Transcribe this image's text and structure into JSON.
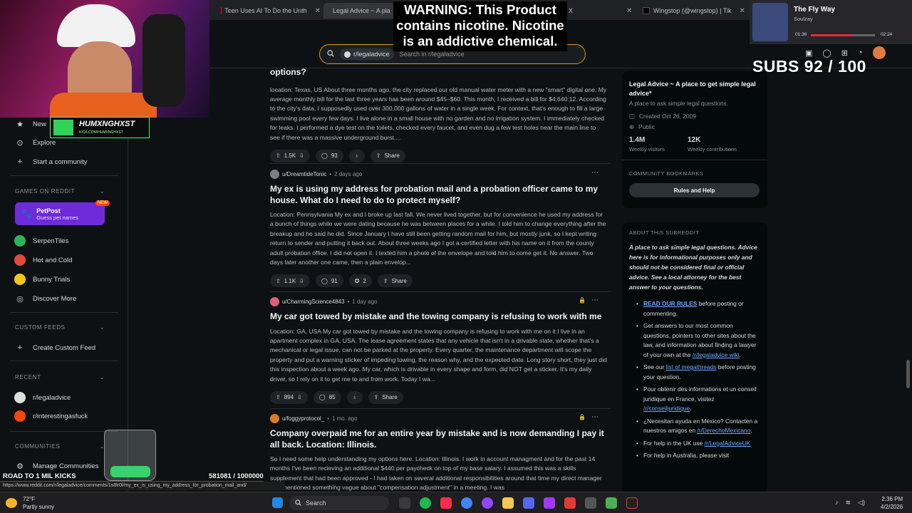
{
  "browser_tabs": [
    {
      "label": "Teen Uses AI To Do the Unth",
      "color": "#ff0000"
    },
    {
      "label": "Legal Advice ~ A pla",
      "color": "#ff4500",
      "active": true
    },
    {
      "label": "X",
      "color": "#ffffff"
    },
    {
      "label": "Wingstop (@wingstop) | Tik",
      "color": "#000000"
    }
  ],
  "search": {
    "community_chip": "r/legaladvice",
    "placeholder": "Search in r/legaladvice"
  },
  "sidebar": {
    "new": "New",
    "explore": "Explore",
    "start_community": "Start a community",
    "games_header": "GAMES ON REDDIT",
    "petpost_title": "PetPost",
    "petpost_sub": "Guess pet names",
    "new_badge": "NEW",
    "games": [
      "SerpenTiles",
      "Hot and Cold",
      "Bunny Trials",
      "Discover More"
    ],
    "custom_feeds_header": "CUSTOM FEEDS",
    "create_custom_feed": "Create Custom Feed",
    "recent_header": "RECENT",
    "recent": [
      "r/legaladvice",
      "r/interestingasfuck"
    ],
    "communities_header": "COMMUNITIES",
    "manage_communities": "Manage Communities"
  },
  "posts": [
    {
      "title_partial": "options?",
      "body": "location: Texas, US About three months ago, the city replaced our old manual water meter with a new \"smart\" digital one. My average monthly bill for the last three years has been around $45–$60. This month, I received a bill for $4,640.12. According to the city's data, I supposedly used over 300,000 gallons of water in a single week. For context, that's enough to fill a large swimming pool every few days. I live alone in a small house with no garden and no irrigation system. I immediately checked for leaks. I performed a dye test on the toilets, checked every faucet, and even dug a few test holes near the main line to see if there was a massive underground burst....",
      "votes": "1.5K",
      "comments": "93",
      "share": "Share"
    },
    {
      "user": "u/DreamtideTonic",
      "time": "2 days ago",
      "title": "My ex is using my address for probation mail and a probation officer came to my house. What do I need to do to protect myself?",
      "body": "Location: Pennsylvania My ex and I broke up last fall. We never lived together, but for convenience he used my address for a bunch of things while we were dating because he was between places for a while. I told him to change everything after the breakup and he said he did. Since January I have still been getting random mail for him, but mostly junk, so I kept writing return to sender and putting it back out. About three weeks ago I got a certified letter with his name on it from the county adult probation office. I did not open it. I texted him a photo of the envelope and told him to come get it. No answer. Two days later another one came, then a plain envelop...",
      "votes": "1.1K",
      "comments": "91",
      "awards": "2",
      "share": "Share"
    },
    {
      "user": "u/CharmingScience4843",
      "time": "1 day ago",
      "title": "My car got towed by mistake and the towing company is refusing to work with me",
      "body": "Location: GA, USA My car got towed by mistake and the towing company is refusing to work with me on it I live in an apartment complex in GA, USA. The lease agreement states that any vehicle that isn't in a drivable state, whether that's a mechanical or legal issue, can not be parked at the property. Every quarter, the maintenance department will scope the property and put a warning sticker of impeding towing, the reason why, and the expected date. Long story short, they just did this inspection about a week ago. My car, which is drivable in every shape and form, did NOT get a sticker. It's my daily driver, so I rely on it to get me to and from work. Today I wa...",
      "votes": "894",
      "comments": "85",
      "share": "Share"
    },
    {
      "user": "u/foggyprotocol_",
      "time": "1 mo. ago",
      "title": "Company overpaid me for an entire year by mistake and is now demanding I pay it all back. Location: Illinois.",
      "body": "So I need some help understanding my options here. Location: Illinois. I work in account managment and for the past 14 months I've been recieving an additional $440 per paycheck on top of my base salary. I assumed this was a skills supplement that had been approved - I had taken on several additional responsibilities around that time my direct manager had mentioned something vague about \"compensation adjustment\" in a meeting. I was"
    }
  ],
  "right": {
    "sub_title": "Legal Advice ~ A place to get simple legal advice*",
    "sub_desc": "A place to ask simple legal questions.",
    "created": "Created Oct 26, 2009",
    "visibility": "Public",
    "weekly_visitors": "1.4M",
    "weekly_visitors_label": "Weekly visitors",
    "weekly_contrib": "12K",
    "weekly_contrib_label": "Weekly contributions",
    "bookmarks_header": "COMMUNITY BOOKMARKS",
    "rules_button": "Rules and Help",
    "about_header": "ABOUT THIS SUBREDDIT",
    "about_text": "A place to ask simple legal questions. Advice here is for informational purposes only and should not be considered final or official advice. See a local attorney for the best answer to your questions.",
    "list": [
      {
        "link": "READ OUR RULES",
        "text": " before posting or commenting."
      },
      {
        "text": "Get answers to our most common questions, pointers to other sites about the law, and information about finding a lawyer of your own at the ",
        "link2": "/r/legaladvice wiki",
        "tail": "."
      },
      {
        "text": "See our ",
        "link2": "list of megathreads",
        "tail": " before posting your question."
      },
      {
        "text": "Pour obtenir des informations et un conseil juridique en France, visitez ",
        "link2": "/r/conseiljuridique",
        "tail": "."
      },
      {
        "text": "¿Necesitan ayuda en México? Contacten a nuestros amigos en ",
        "link2": "/r/DerechoMexicano",
        "tail": "."
      },
      {
        "text": "For help in the UK use ",
        "link2": "/r/LegalAdviceUK",
        "tail": ""
      },
      {
        "text": "For help in Australia, please visit",
        "link2": "",
        "tail": ""
      }
    ]
  },
  "overlay": {
    "warning": "WARNING: This Product contains nicotine. Nicotine is an addictive chemical.",
    "subs": "SUBS 92 / 100",
    "music_title": "The Fly Way",
    "music_artist": "Soulzay",
    "music_time_start": "01:36",
    "music_time_end": "02:24",
    "streamer_name": "HUMXNGHXST",
    "streamer_sub": "KICK.COM/HUMXNGHXST",
    "goal_left": "ROAD TO 1 MIL KICKS",
    "goal_right": "581081 / 1000000",
    "goal_progress": 0.581081,
    "status_url": "https://www.reddit.com/r/legaladvice/comments/1s8lr0l/my_ex_is_using_my_address_for_probation_mail_and/"
  },
  "taskbar": {
    "temp": "72°F",
    "weather": "Partly sunny",
    "search": "Search",
    "time": "2:36 PM",
    "date": "4/2/2026"
  }
}
